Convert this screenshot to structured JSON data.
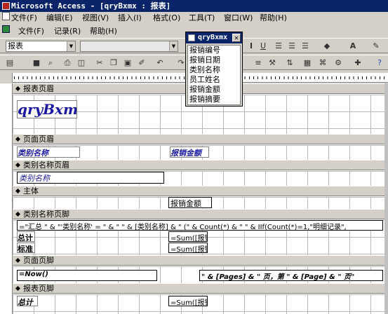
{
  "window": {
    "title": "Microsoft Access - [qryBxmx : 报表]"
  },
  "menubar1": [
    "文件(F)",
    "编辑(E)",
    "视图(V)",
    "插入(I)",
    "格式(O)",
    "工具(T)",
    "窗口(W)",
    "帮助(H)"
  ],
  "menubar2": [
    "文件(F)",
    "记录(R)",
    "帮助(H)"
  ],
  "toolbar": {
    "object_combo": "报表"
  },
  "sections": {
    "report_header": "报表页眉",
    "page_header": "页面页眉",
    "group_header": "类别名称页眉",
    "detail": "主体",
    "group_footer": "类别名称页脚",
    "page_footer": "页面页脚",
    "report_footer": "报表页脚"
  },
  "controls": {
    "report_title": "qryBxm",
    "ph_label_category": "类别名称",
    "ph_label_amount": "报销金额",
    "gh_category": "类别名称",
    "detail_amount": "报销金额",
    "gf_summary": "=\"汇总 \" & \"'类别名称' = \" & \" \" & [类别名称] & \" (\" & Count(*) & \" \" & IIf(Count(*)=1,\"明细记录\",",
    "gf_total_label": "总计",
    "gf_total_expr": "=Sum([报销",
    "gf_std_label": "标准",
    "gf_std_expr": "=Sum([报销",
    "pf_now": "=Now()",
    "pf_pages": "\" & [Pages] & \" 页，第 \" & [Page] & \" 页\"",
    "rf_total_label": "总计",
    "rf_total_expr": "=Sum([报销"
  },
  "field_list": {
    "title": "qryBxmx",
    "fields": [
      "报销编号",
      "报销日期",
      "类别名称",
      "员工姓名",
      "报销金额",
      "报销摘要"
    ]
  }
}
